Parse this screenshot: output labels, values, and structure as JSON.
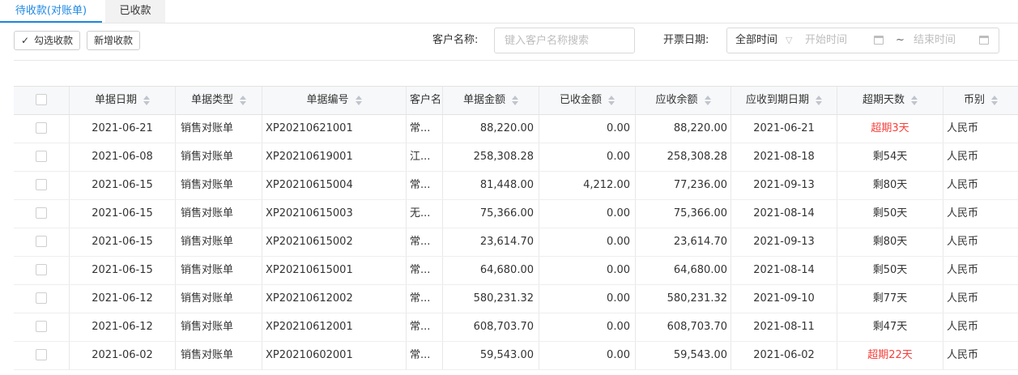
{
  "tabs": [
    {
      "label": "待收款(对账单)",
      "active": true
    },
    {
      "label": "已收款",
      "active": false
    }
  ],
  "toolbar": {
    "check_collect_label": "勾选收款",
    "new_collect_label": "新增收款"
  },
  "filters": {
    "customer_label": "客户名称:",
    "customer_placeholder": "键入客户名称搜索",
    "date_label": "开票日期:",
    "date_range_value": "全部时间",
    "start_placeholder": "开始时间",
    "end_placeholder": "结束时间",
    "range_separator": "~"
  },
  "table": {
    "columns": [
      "单据日期",
      "单据类型",
      "单据编号",
      "客户名",
      "单据金额",
      "已收金额",
      "应收余额",
      "应收到期日期",
      "超期天数",
      "币别"
    ],
    "rows": [
      {
        "date": "2021-06-21",
        "type": "销售对账单",
        "no": "XP20210621001",
        "customer": "常...",
        "amount": "88,220.00",
        "received": "0.00",
        "balance": "88,220.00",
        "due": "2021-06-21",
        "days": "超期3天",
        "overdue": true,
        "currency": "人民币"
      },
      {
        "date": "2021-06-08",
        "type": "销售对账单",
        "no": "XP20210619001",
        "customer": "江...",
        "amount": "258,308.28",
        "received": "0.00",
        "balance": "258,308.28",
        "due": "2021-08-18",
        "days": "剩54天",
        "overdue": false,
        "currency": "人民币"
      },
      {
        "date": "2021-06-15",
        "type": "销售对账单",
        "no": "XP20210615004",
        "customer": "常...",
        "amount": "81,448.00",
        "received": "4,212.00",
        "balance": "77,236.00",
        "due": "2021-09-13",
        "days": "剩80天",
        "overdue": false,
        "currency": "人民币"
      },
      {
        "date": "2021-06-15",
        "type": "销售对账单",
        "no": "XP20210615003",
        "customer": "无...",
        "amount": "75,366.00",
        "received": "0.00",
        "balance": "75,366.00",
        "due": "2021-08-14",
        "days": "剩50天",
        "overdue": false,
        "currency": "人民币"
      },
      {
        "date": "2021-06-15",
        "type": "销售对账单",
        "no": "XP20210615002",
        "customer": "常...",
        "amount": "23,614.70",
        "received": "0.00",
        "balance": "23,614.70",
        "due": "2021-09-13",
        "days": "剩80天",
        "overdue": false,
        "currency": "人民币"
      },
      {
        "date": "2021-06-15",
        "type": "销售对账单",
        "no": "XP20210615001",
        "customer": "常...",
        "amount": "64,680.00",
        "received": "0.00",
        "balance": "64,680.00",
        "due": "2021-08-14",
        "days": "剩50天",
        "overdue": false,
        "currency": "人民币"
      },
      {
        "date": "2021-06-12",
        "type": "销售对账单",
        "no": "XP20210612002",
        "customer": "常...",
        "amount": "580,231.32",
        "received": "0.00",
        "balance": "580,231.32",
        "due": "2021-09-10",
        "days": "剩77天",
        "overdue": false,
        "currency": "人民币"
      },
      {
        "date": "2021-06-12",
        "type": "销售对账单",
        "no": "XP20210612001",
        "customer": "常...",
        "amount": "608,703.70",
        "received": "0.00",
        "balance": "608,703.70",
        "due": "2021-08-11",
        "days": "剩47天",
        "overdue": false,
        "currency": "人民币"
      },
      {
        "date": "2021-06-02",
        "type": "销售对账单",
        "no": "XP20210602001",
        "customer": "常...",
        "amount": "59,543.00",
        "received": "0.00",
        "balance": "59,543.00",
        "due": "2021-06-02",
        "days": "超期22天",
        "overdue": true,
        "currency": "人民币"
      }
    ]
  },
  "colors": {
    "accent": "#1e88e5",
    "overdue": "#f5403c"
  }
}
